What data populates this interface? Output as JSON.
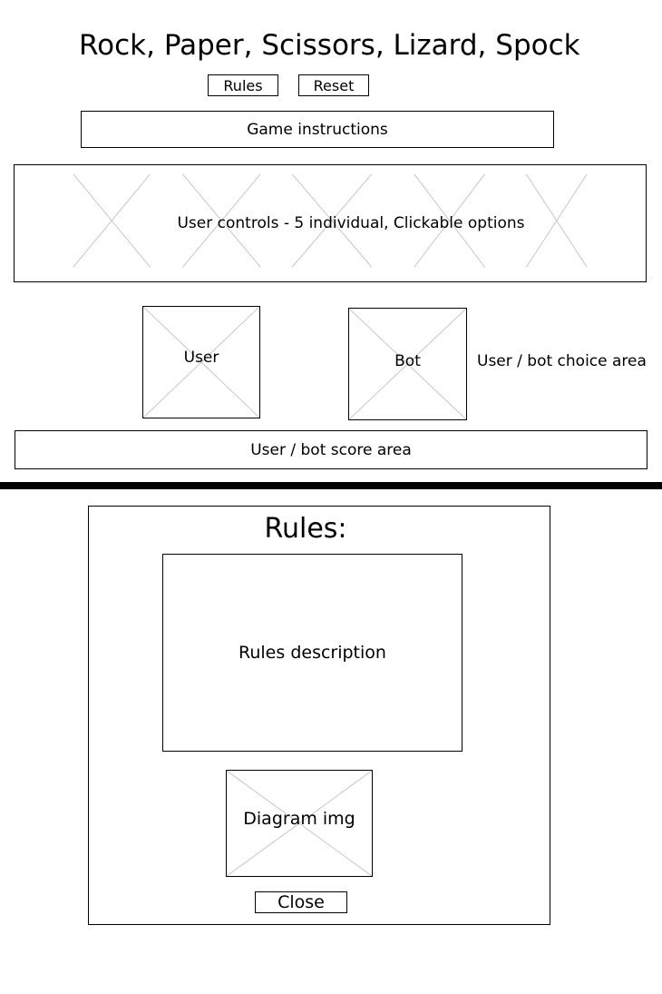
{
  "header": {
    "title": "Rock, Paper, Scissors, Lizard, Spock",
    "rules_button": "Rules",
    "reset_button": "Reset"
  },
  "instructions": {
    "label": "Game instructions"
  },
  "controls": {
    "label": "User controls - 5 individual, Clickable options",
    "option_count": 5
  },
  "choice_area": {
    "user_label": "User",
    "bot_label": "Bot",
    "caption": "User / bot choice area"
  },
  "score_area": {
    "label": "User / bot score area"
  },
  "rules_modal": {
    "title": "Rules:",
    "description": "Rules description",
    "diagram_label": "Diagram img",
    "close_button": "Close"
  }
}
